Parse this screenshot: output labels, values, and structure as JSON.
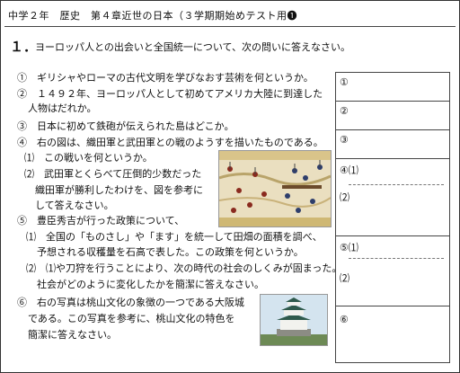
{
  "header": {
    "title": "中学２年　歴史　第４章近世の日本（３学期期始めテスト用❶"
  },
  "question": {
    "number": "１．",
    "text": "ヨーロッパ人との出会いと全国統一について、次の問いに答えなさい。"
  },
  "items": [
    "①　ギリシャやローマの古代文明を学びなおす芸術を何というか。",
    "②　１４９２年、ヨーロッパ人として初めてアメリカ大陸に到達した",
    "人物はだれか。",
    "③　日本に初めて鉄砲が伝えられた島はどこか。",
    "④　右の図は、織田軍と武田軍との戦のようすを描いたものである。",
    "⑴　この戦いを何というか。",
    "⑵　武田軍とくらべて圧倒的少数だった",
    "織田軍が勝利したわけを、図を参考に",
    "して答えなさい。",
    "⑤　豊臣秀吉が行った政策について、",
    "⑴　全国の「ものさし」や「ます」を統一して田畑の面積を調べ、",
    "予想される収穫量を石高で表した。この政策を何というか。",
    "⑵　⑴や刀狩を行うことにより、次の時代の社会のしくみが固まった。",
    "社会がどのように変化したかを簡潔に答えなさい。",
    "⑥　右の写真は桃山文化の象徴の一つである大阪城",
    "である。この写真を参考に、桃山文化の特色を",
    "簡潔に答えなさい。"
  ],
  "answers": {
    "a1": "①",
    "a2": "②",
    "a3": "③",
    "a4": "④⑴",
    "a4b": "⑵",
    "a5": "⑤⑴",
    "a5b": "⑵",
    "a6": "⑥"
  }
}
